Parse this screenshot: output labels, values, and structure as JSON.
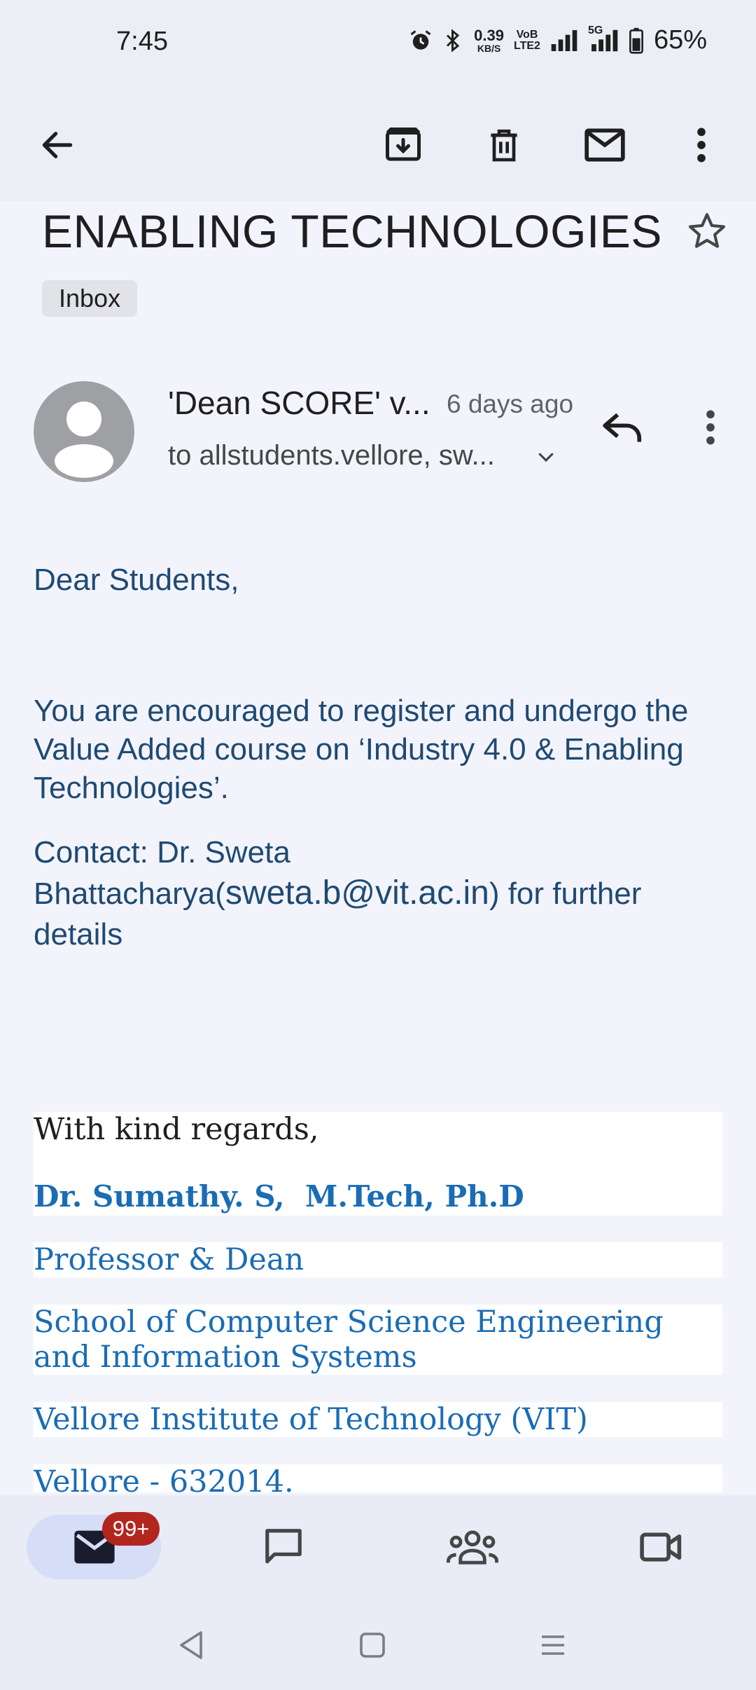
{
  "status_bar": {
    "time": "7:45",
    "net_speed": "0.39",
    "net_unit": "KB/S",
    "volte_top": "VoB",
    "volte_bottom": "LTE2",
    "network_5g": "5G",
    "battery": "65%"
  },
  "toolbar": {
    "icons": [
      "back-arrow-icon",
      "archive-icon",
      "delete-icon",
      "mark-unread-icon",
      "more-vert-icon"
    ]
  },
  "email": {
    "subject": "ENABLING TECHNOLOGIES",
    "label": "Inbox",
    "sender": "'Dean SCORE' v...",
    "time": "6 days ago",
    "recipients": "to allstudents.vellore, sw...",
    "body": {
      "greeting": "Dear Students,",
      "para1": "You are encouraged to register and undergo the Value Added course on ‘Industry 4.0 & Enabling Technologies’.",
      "para2_start": "Contact: Dr. Sweta Bhattacharya(",
      "para2_email": "sweta.b@vit.ac.in",
      "para2_end": ") for further details"
    },
    "signature": {
      "regards": "With kind regards,",
      "name": "Dr. Sumathy. S,  M.Tech, Ph.D",
      "title": "Professor & Dean",
      "school": "School of Computer Science Engineering and Information Systems",
      "institute": "Vellore Institute of Technology (VIT)",
      "city": "Vellore - 632014."
    }
  },
  "bottom_nav": {
    "items": [
      "mail-icon",
      "chat-icon",
      "spaces-icon",
      "meet-icon"
    ],
    "mail_badge": "99+",
    "active_color": "#d6def7",
    "badge_color": "#b3261e"
  },
  "colors": {
    "body_text": "#1f4a73",
    "signature_link": "#1a6cb4",
    "background": "#f3f4fb"
  }
}
